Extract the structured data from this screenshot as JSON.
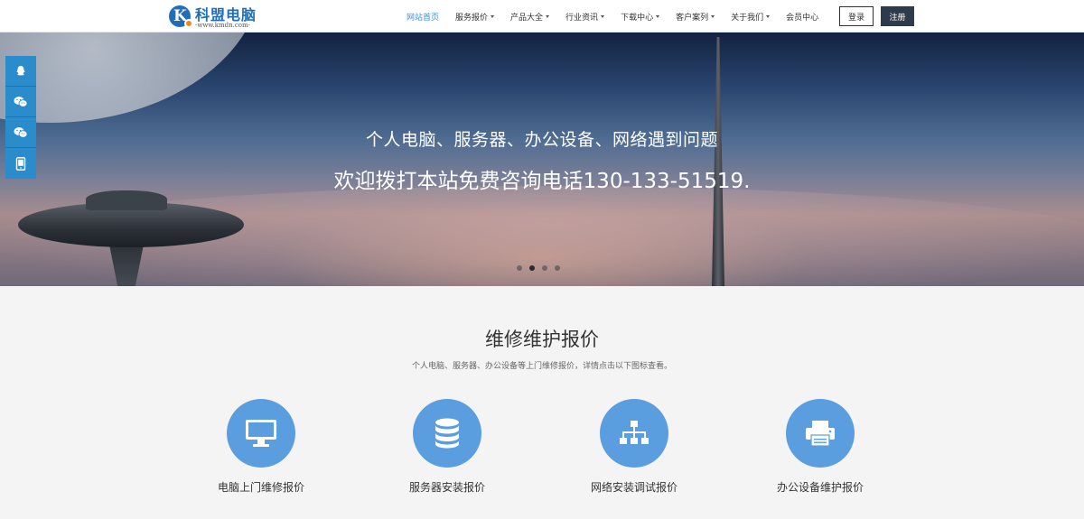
{
  "header": {
    "logo": {
      "name": "科盟电脑",
      "url": "-www.kmdn.com-"
    },
    "nav": [
      {
        "label": "网站首页",
        "dropdown": false,
        "active": true
      },
      {
        "label": "服务报价",
        "dropdown": true,
        "active": false
      },
      {
        "label": "产品大全",
        "dropdown": true,
        "active": false
      },
      {
        "label": "行业资讯",
        "dropdown": true,
        "active": false
      },
      {
        "label": "下载中心",
        "dropdown": true,
        "active": false
      },
      {
        "label": "客户案列",
        "dropdown": true,
        "active": false
      },
      {
        "label": "关于我们",
        "dropdown": true,
        "active": false
      },
      {
        "label": "会员中心",
        "dropdown": false,
        "active": false
      }
    ],
    "login_label": "登录",
    "register_label": "注册"
  },
  "side_float": [
    {
      "icon": "qq-icon"
    },
    {
      "icon": "wechat-icon"
    },
    {
      "icon": "wechat-icon"
    },
    {
      "icon": "phone-icon"
    }
  ],
  "hero": {
    "line1": "个人电脑、服务器、办公设备、网络遇到问题",
    "line2": "欢迎拨打本站免费咨询电话130-133-51519.",
    "slide_count": 4,
    "active_slide": 2
  },
  "section": {
    "title": "维修维护报价",
    "subtitle": "个人电脑、服务器、办公设备等上门维修报价，详情点击以下图标查看。",
    "cards": [
      {
        "icon": "monitor-icon",
        "label": "电脑上门维修报价"
      },
      {
        "icon": "database-icon",
        "label": "服务器安装报价"
      },
      {
        "icon": "network-icon",
        "label": "网络安装调试报价"
      },
      {
        "icon": "printer-icon",
        "label": "办公设备维护报价"
      }
    ]
  },
  "colors": {
    "accent": "#3a8ee6",
    "icon_circle": "#5b9ee0",
    "side_float": "#2b8ccb",
    "register_button": "#2e3b4a"
  }
}
